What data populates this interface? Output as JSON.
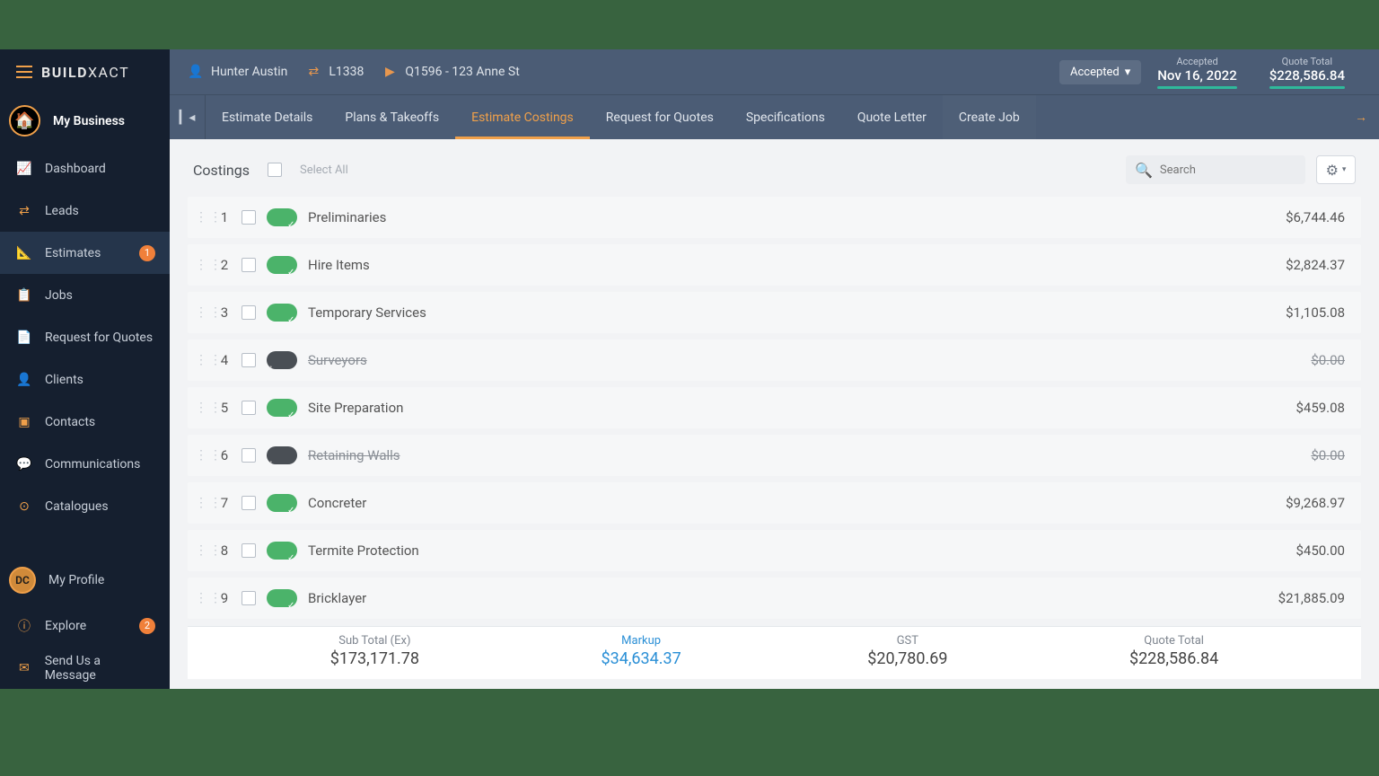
{
  "logo_prefix": "BUILD",
  "logo_suffix": "XACT",
  "my_business_label": "My Business",
  "nav": [
    {
      "label": "Dashboard",
      "icon": "chart-icon"
    },
    {
      "label": "Leads",
      "icon": "leads-icon"
    },
    {
      "label": "Estimates",
      "icon": "estimate-icon",
      "active": true,
      "badge": "1"
    },
    {
      "label": "Jobs",
      "icon": "jobs-icon"
    },
    {
      "label": "Request for Quotes",
      "icon": "rfq-icon"
    },
    {
      "label": "Clients",
      "icon": "clients-icon"
    },
    {
      "label": "Contacts",
      "icon": "contacts-icon"
    },
    {
      "label": "Communications",
      "icon": "comm-icon"
    },
    {
      "label": "Catalogues",
      "icon": "catalogue-icon"
    }
  ],
  "profile": {
    "initials": "DC",
    "label": "My Profile"
  },
  "bottom_nav": [
    {
      "label": "Explore",
      "icon": "explore-icon",
      "badge": "2"
    },
    {
      "label": "Send Us a Message",
      "icon": "msg-icon"
    }
  ],
  "breadcrumb": {
    "owner": "Hunter Austin",
    "lead": "L1338",
    "quote": "Q1596 - 123 Anne St"
  },
  "status_label": "Accepted",
  "kpis": [
    {
      "label": "Accepted",
      "value": "Nov 16, 2022"
    },
    {
      "label": "Quote Total",
      "value": "$228,586.84"
    }
  ],
  "tabs": [
    {
      "label": "Estimate Details"
    },
    {
      "label": "Plans & Takeoffs"
    },
    {
      "label": "Estimate Costings",
      "active": true
    },
    {
      "label": "Request for Quotes"
    },
    {
      "label": "Specifications"
    },
    {
      "label": "Quote Letter"
    },
    {
      "label": "Create Job",
      "dim": true
    }
  ],
  "panel_title": "Costings",
  "select_all_label": "Select All",
  "search_placeholder": "Search",
  "rows": [
    {
      "n": "1",
      "name": "Preliminaries",
      "price": "$6,744.46",
      "on": true
    },
    {
      "n": "2",
      "name": "Hire Items",
      "price": "$2,824.37",
      "on": true
    },
    {
      "n": "3",
      "name": "Temporary Services",
      "price": "$1,105.08",
      "on": true
    },
    {
      "n": "4",
      "name": "Surveyors",
      "price": "$0.00",
      "on": false
    },
    {
      "n": "5",
      "name": "Site Preparation",
      "price": "$459.08",
      "on": true
    },
    {
      "n": "6",
      "name": "Retaining Walls",
      "price": "$0.00",
      "on": false
    },
    {
      "n": "7",
      "name": "Concreter",
      "price": "$9,268.97",
      "on": true
    },
    {
      "n": "8",
      "name": "Termite Protection",
      "price": "$450.00",
      "on": true
    },
    {
      "n": "9",
      "name": "Bricklayer",
      "price": "$21,885.09",
      "on": true
    }
  ],
  "footer": [
    {
      "label": "Sub Total (Ex)",
      "value": "$173,171.78"
    },
    {
      "label": "Markup",
      "value": "$34,634.37",
      "markup": true
    },
    {
      "label": "GST",
      "value": "$20,780.69"
    },
    {
      "label": "Quote Total",
      "value": "$228,586.84"
    }
  ]
}
